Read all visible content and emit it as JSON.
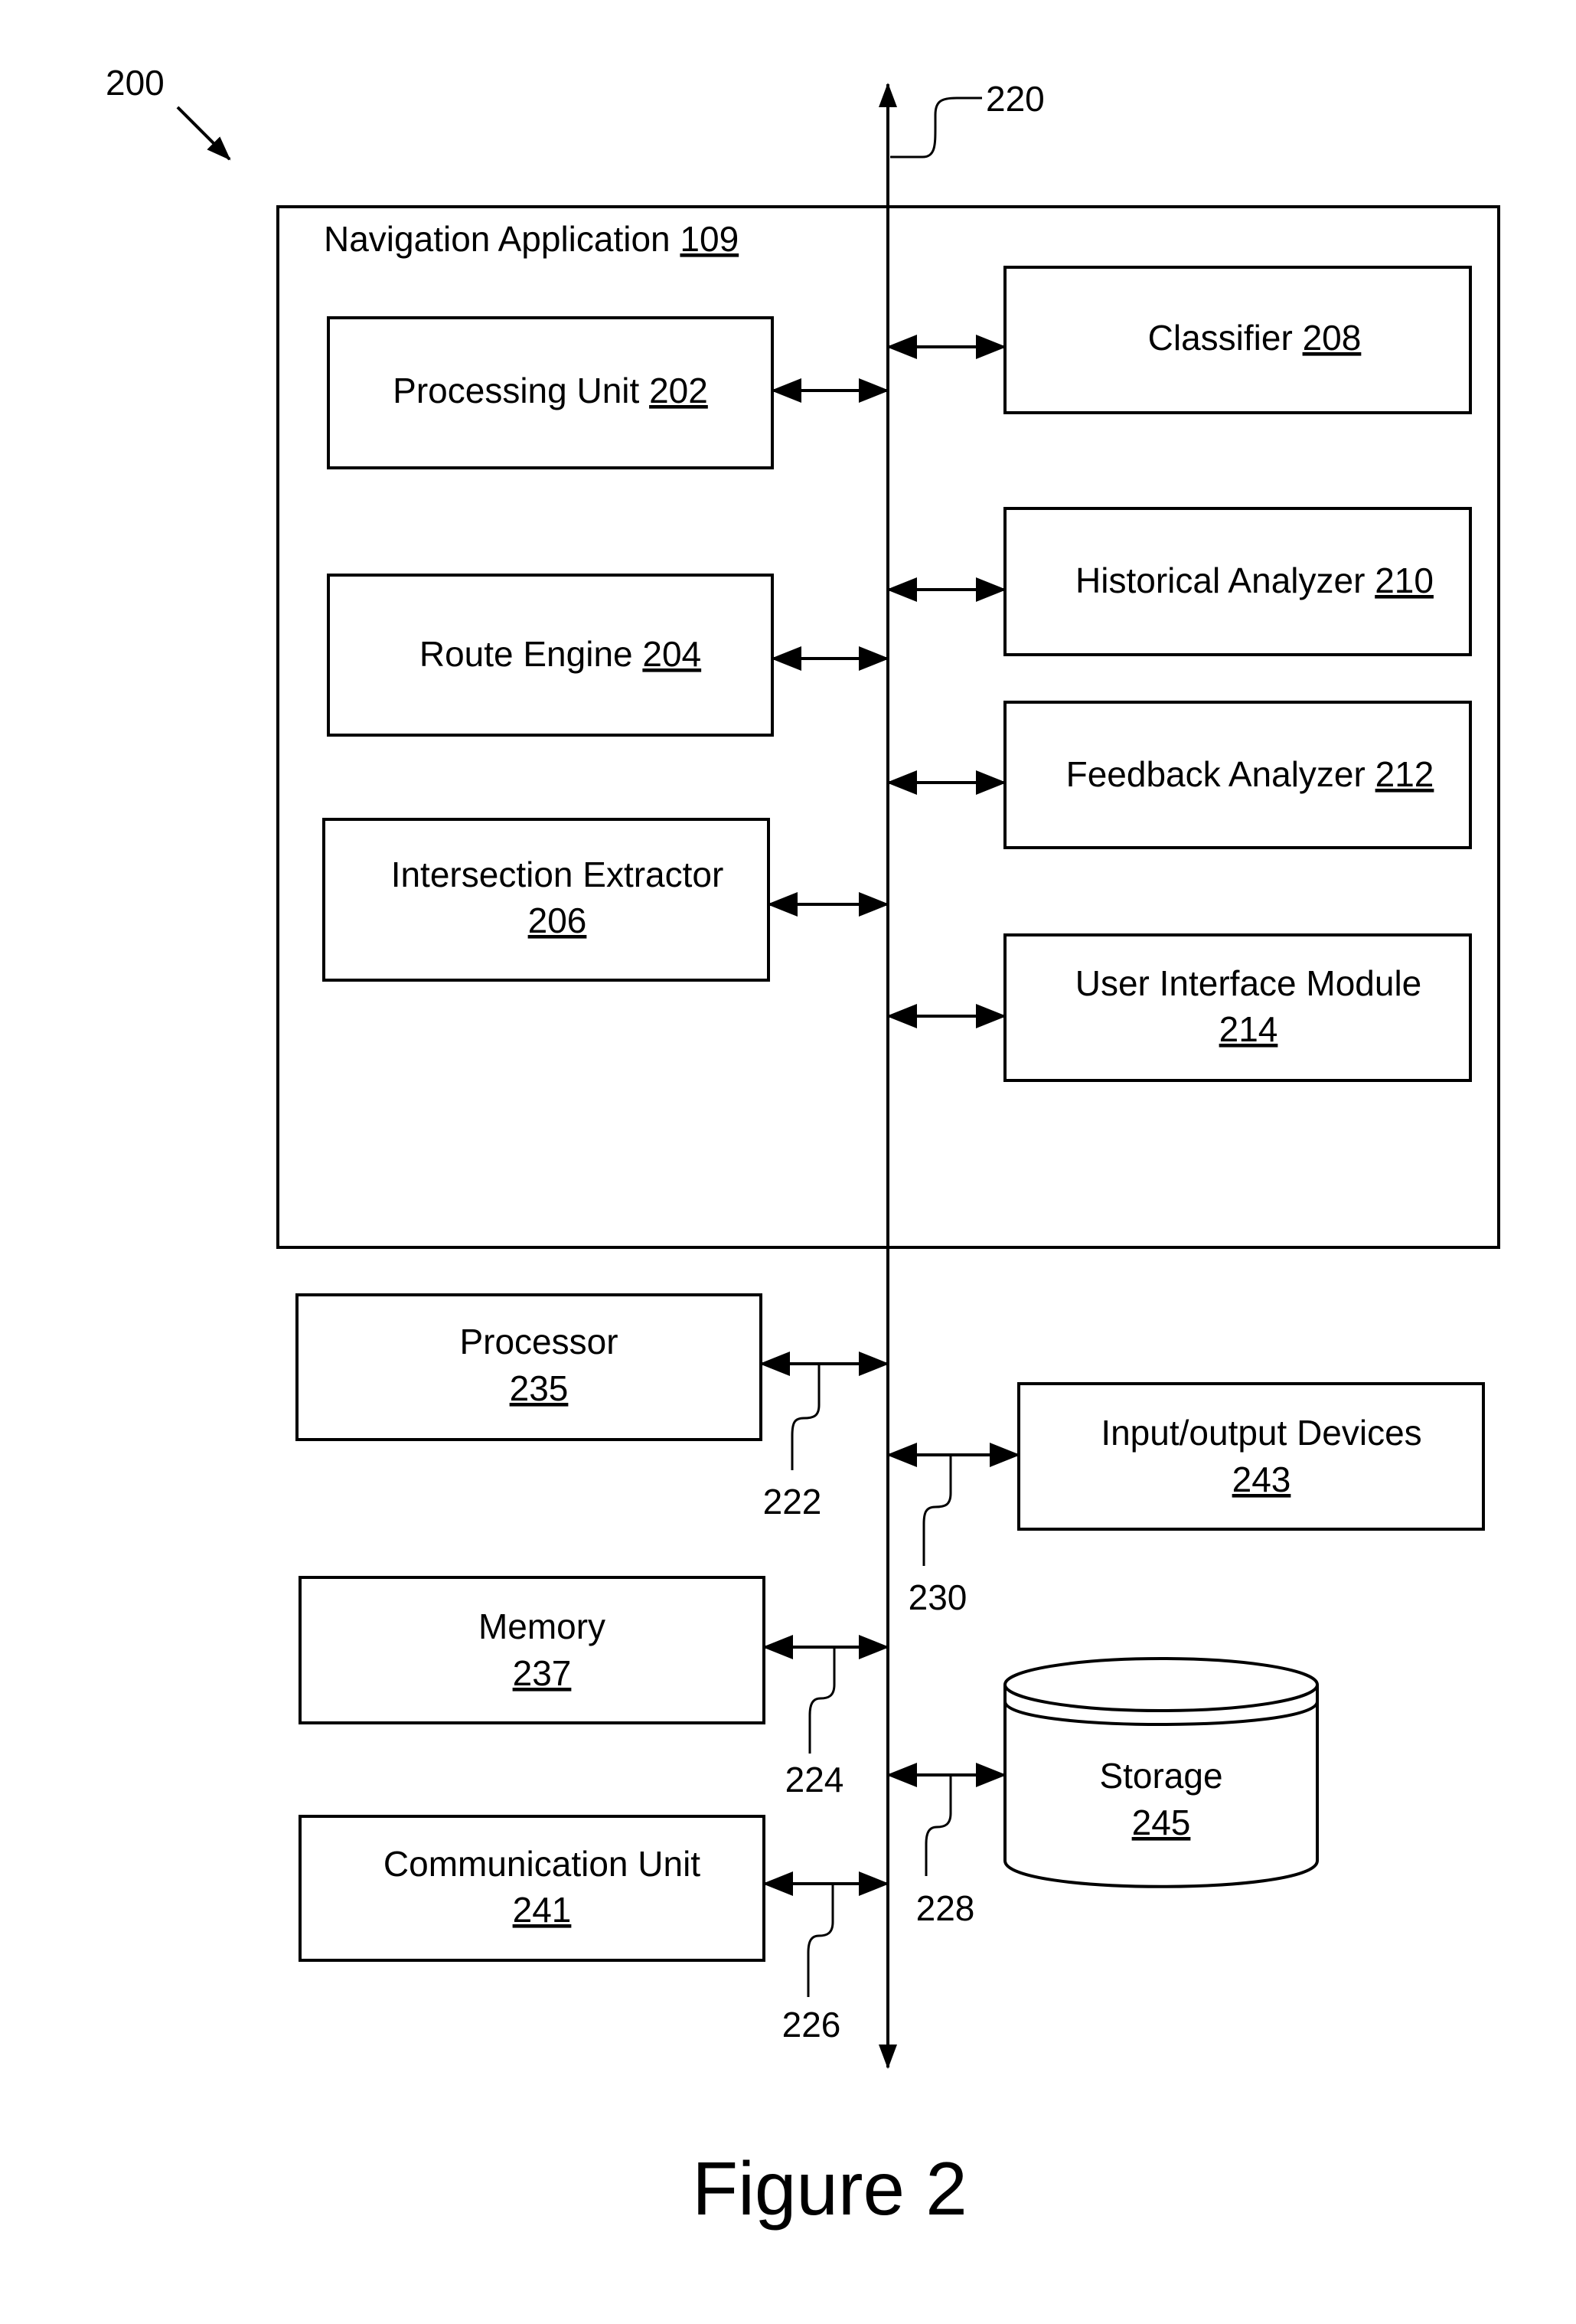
{
  "figure": {
    "ref_label": "200",
    "bus_label": "220",
    "caption": "Figure 2"
  },
  "container": {
    "title": "Navigation Application",
    "num": "109"
  },
  "modules": {
    "processing_unit": {
      "line1": "Processing Unit",
      "num": "202"
    },
    "route_engine": {
      "line1": "Route Engine",
      "num": "204"
    },
    "intersection_extractor": {
      "line1": "Intersection Extractor",
      "num": "206"
    },
    "classifier": {
      "line1": "Classifier",
      "num": "208"
    },
    "historical_analyzer": {
      "line1": "Historical Analyzer",
      "num": "210"
    },
    "feedback_analyzer": {
      "line1": "Feedback Analyzer",
      "num": "212"
    },
    "ui_module": {
      "line1": "User Interface Module",
      "num": "214"
    }
  },
  "hardware": {
    "processor": {
      "line1": "Processor",
      "num": "235",
      "link": "222"
    },
    "memory": {
      "line1": "Memory",
      "num": "237",
      "link": "224"
    },
    "comm_unit": {
      "line1": "Communication Unit",
      "num": "241",
      "link": "226"
    },
    "io_devices": {
      "line1": "Input/output Devices",
      "num": "243",
      "link": "230"
    },
    "storage": {
      "line1": "Storage",
      "num": "245",
      "link": "228"
    }
  }
}
